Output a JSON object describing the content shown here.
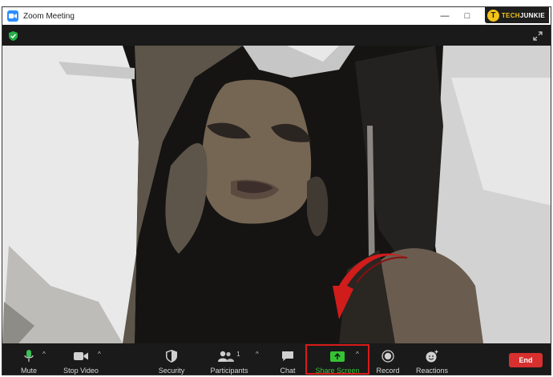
{
  "window": {
    "title": "Zoom Meeting",
    "controls": {
      "minimize": "—",
      "maximize": "□",
      "close": "✕"
    }
  },
  "brand": {
    "logo_letter": "T",
    "tech": "TECH",
    "junkie": "JUNKIE"
  },
  "icons": {
    "encryption": "shield-check-icon",
    "fullscreen": "expand-icon"
  },
  "toolbar": {
    "mute": "Mute",
    "stop_video": "Stop Video",
    "security": "Security",
    "participants": "Participants",
    "participants_count": "1",
    "chat": "Chat",
    "share_screen": "Share Screen",
    "record": "Record",
    "reactions": "Reactions",
    "end": "End"
  },
  "colors": {
    "accent_share": "#35c235",
    "highlight_box": "#d91a1a",
    "end_button": "#d8302f",
    "annotation_arrow": "#d11c1c"
  }
}
